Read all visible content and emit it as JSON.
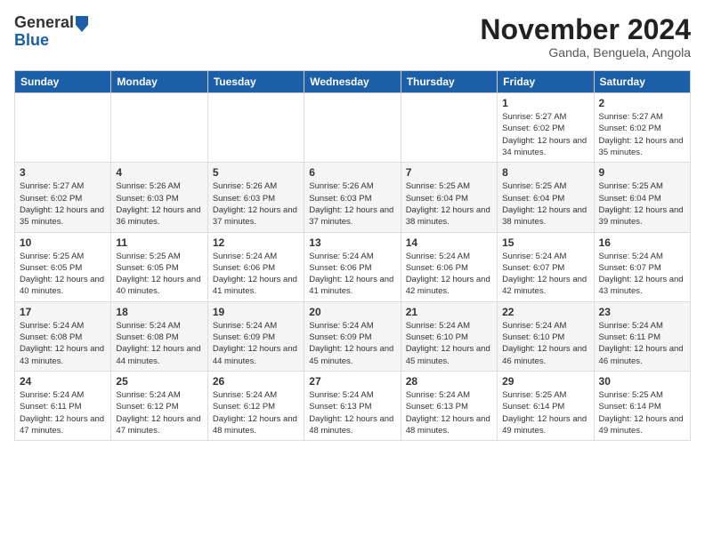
{
  "header": {
    "logo": {
      "line1": "General",
      "line2": "Blue"
    },
    "title": "November 2024",
    "location": "Ganda, Benguela, Angola"
  },
  "weekdays": [
    "Sunday",
    "Monday",
    "Tuesday",
    "Wednesday",
    "Thursday",
    "Friday",
    "Saturday"
  ],
  "weeks": [
    [
      {
        "day": "",
        "info": ""
      },
      {
        "day": "",
        "info": ""
      },
      {
        "day": "",
        "info": ""
      },
      {
        "day": "",
        "info": ""
      },
      {
        "day": "",
        "info": ""
      },
      {
        "day": "1",
        "info": "Sunrise: 5:27 AM\nSunset: 6:02 PM\nDaylight: 12 hours and 34 minutes."
      },
      {
        "day": "2",
        "info": "Sunrise: 5:27 AM\nSunset: 6:02 PM\nDaylight: 12 hours and 35 minutes."
      }
    ],
    [
      {
        "day": "3",
        "info": "Sunrise: 5:27 AM\nSunset: 6:02 PM\nDaylight: 12 hours and 35 minutes."
      },
      {
        "day": "4",
        "info": "Sunrise: 5:26 AM\nSunset: 6:03 PM\nDaylight: 12 hours and 36 minutes."
      },
      {
        "day": "5",
        "info": "Sunrise: 5:26 AM\nSunset: 6:03 PM\nDaylight: 12 hours and 37 minutes."
      },
      {
        "day": "6",
        "info": "Sunrise: 5:26 AM\nSunset: 6:03 PM\nDaylight: 12 hours and 37 minutes."
      },
      {
        "day": "7",
        "info": "Sunrise: 5:25 AM\nSunset: 6:04 PM\nDaylight: 12 hours and 38 minutes."
      },
      {
        "day": "8",
        "info": "Sunrise: 5:25 AM\nSunset: 6:04 PM\nDaylight: 12 hours and 38 minutes."
      },
      {
        "day": "9",
        "info": "Sunrise: 5:25 AM\nSunset: 6:04 PM\nDaylight: 12 hours and 39 minutes."
      }
    ],
    [
      {
        "day": "10",
        "info": "Sunrise: 5:25 AM\nSunset: 6:05 PM\nDaylight: 12 hours and 40 minutes."
      },
      {
        "day": "11",
        "info": "Sunrise: 5:25 AM\nSunset: 6:05 PM\nDaylight: 12 hours and 40 minutes."
      },
      {
        "day": "12",
        "info": "Sunrise: 5:24 AM\nSunset: 6:06 PM\nDaylight: 12 hours and 41 minutes."
      },
      {
        "day": "13",
        "info": "Sunrise: 5:24 AM\nSunset: 6:06 PM\nDaylight: 12 hours and 41 minutes."
      },
      {
        "day": "14",
        "info": "Sunrise: 5:24 AM\nSunset: 6:06 PM\nDaylight: 12 hours and 42 minutes."
      },
      {
        "day": "15",
        "info": "Sunrise: 5:24 AM\nSunset: 6:07 PM\nDaylight: 12 hours and 42 minutes."
      },
      {
        "day": "16",
        "info": "Sunrise: 5:24 AM\nSunset: 6:07 PM\nDaylight: 12 hours and 43 minutes."
      }
    ],
    [
      {
        "day": "17",
        "info": "Sunrise: 5:24 AM\nSunset: 6:08 PM\nDaylight: 12 hours and 43 minutes."
      },
      {
        "day": "18",
        "info": "Sunrise: 5:24 AM\nSunset: 6:08 PM\nDaylight: 12 hours and 44 minutes."
      },
      {
        "day": "19",
        "info": "Sunrise: 5:24 AM\nSunset: 6:09 PM\nDaylight: 12 hours and 44 minutes."
      },
      {
        "day": "20",
        "info": "Sunrise: 5:24 AM\nSunset: 6:09 PM\nDaylight: 12 hours and 45 minutes."
      },
      {
        "day": "21",
        "info": "Sunrise: 5:24 AM\nSunset: 6:10 PM\nDaylight: 12 hours and 45 minutes."
      },
      {
        "day": "22",
        "info": "Sunrise: 5:24 AM\nSunset: 6:10 PM\nDaylight: 12 hours and 46 minutes."
      },
      {
        "day": "23",
        "info": "Sunrise: 5:24 AM\nSunset: 6:11 PM\nDaylight: 12 hours and 46 minutes."
      }
    ],
    [
      {
        "day": "24",
        "info": "Sunrise: 5:24 AM\nSunset: 6:11 PM\nDaylight: 12 hours and 47 minutes."
      },
      {
        "day": "25",
        "info": "Sunrise: 5:24 AM\nSunset: 6:12 PM\nDaylight: 12 hours and 47 minutes."
      },
      {
        "day": "26",
        "info": "Sunrise: 5:24 AM\nSunset: 6:12 PM\nDaylight: 12 hours and 48 minutes."
      },
      {
        "day": "27",
        "info": "Sunrise: 5:24 AM\nSunset: 6:13 PM\nDaylight: 12 hours and 48 minutes."
      },
      {
        "day": "28",
        "info": "Sunrise: 5:24 AM\nSunset: 6:13 PM\nDaylight: 12 hours and 48 minutes."
      },
      {
        "day": "29",
        "info": "Sunrise: 5:25 AM\nSunset: 6:14 PM\nDaylight: 12 hours and 49 minutes."
      },
      {
        "day": "30",
        "info": "Sunrise: 5:25 AM\nSunset: 6:14 PM\nDaylight: 12 hours and 49 minutes."
      }
    ]
  ]
}
